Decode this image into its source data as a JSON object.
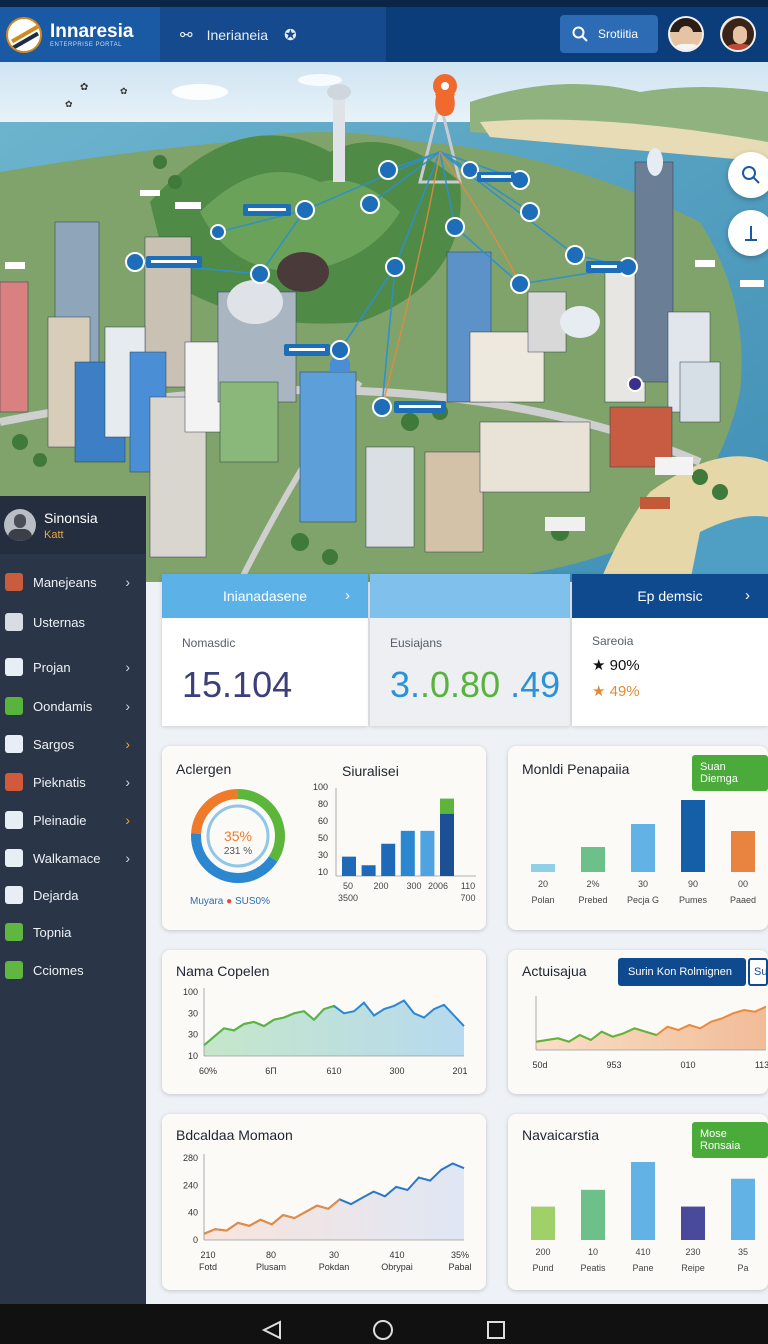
{
  "header": {
    "brand_title": "Innaresia",
    "brand_subtitle": "ENTERPRISE PORTAL",
    "nav_tab_label": "Inerianeia",
    "search_label": "Srotiitia"
  },
  "map": {
    "pin_color": "#ef6a2c"
  },
  "profile": {
    "name": "Sinonsia",
    "role": "Katt"
  },
  "sidebar": {
    "items": [
      {
        "label": "Manejeans",
        "icon": "folder-icon",
        "color": "#c95c3c",
        "chevron": true
      },
      {
        "label": "Usternas",
        "icon": "gear-icon",
        "color": "#d8dde4",
        "chevron": false
      },
      {
        "label": "Projan",
        "icon": "briefcase-icon",
        "color": "#e8eef6",
        "chevron": true
      },
      {
        "label": "Oondamis",
        "icon": "calendar-icon",
        "color": "#58b43c",
        "chevron": true
      },
      {
        "label": "Sargos",
        "icon": "table-icon",
        "color": "#e8eef6",
        "chevron": true,
        "chevron_color": "#e7a93a"
      },
      {
        "label": "Pieknatis",
        "icon": "tools-icon",
        "color": "#d05a3a",
        "chevron": true
      },
      {
        "label": "Pleinadie",
        "icon": "network-icon",
        "color": "#e8eef6",
        "chevron": true,
        "chevron_color": "#e7a93a"
      },
      {
        "label": "Walkamace",
        "icon": "puzzle-icon",
        "color": "#e8eef6",
        "chevron": true
      },
      {
        "label": "Dejarda",
        "icon": "gauge-icon",
        "color": "#e8eef6",
        "chevron": false
      },
      {
        "label": "Topnia",
        "icon": "monitor-icon",
        "color": "#5fb641",
        "chevron": false
      },
      {
        "label": "Cciomes",
        "icon": "key-icon",
        "color": "#5fb641",
        "chevron": false
      }
    ]
  },
  "kpis": [
    {
      "head": "Inianadasene",
      "label": "Nomasdic",
      "value": "15.104"
    },
    {
      "head": "",
      "label": "Eusiajans",
      "value_parts": [
        "3.",
        ".0.80",
        " .49"
      ]
    },
    {
      "head": "Ep demsic",
      "label": "Sareoia",
      "line1": "★ 90%",
      "line2": "★ 49%"
    }
  ],
  "cards": {
    "allergen": {
      "title": "Aclergen",
      "donut_top": "35%",
      "donut_bottom": "231 %",
      "legend_a": "Muyara",
      "legend_b": "SUS0%",
      "subchart_title": "Siuralisei"
    },
    "pers": {
      "title": "Monldi Penapaiia",
      "button": "Suan Diemga"
    },
    "nama": {
      "title": "Nama Copelen"
    },
    "activ": {
      "title": "Actuisajua",
      "button": "Surin Kon Rolmignen",
      "button2": "Su"
    },
    "bdc": {
      "title": "Bdcaldaa Momaon"
    },
    "nav": {
      "title": "Navaicarstia",
      "button": "Mose Ronsaia"
    }
  },
  "chart_data": [
    {
      "type": "bar",
      "title": "Siuralisei",
      "categories": [
        "50",
        "200",
        "300",
        "2006",
        "110"
      ],
      "categories_line2": [
        "3500",
        "",
        "",
        "",
        "700"
      ],
      "values": [
        18,
        10,
        30,
        42,
        42,
        58
      ],
      "overlay_top": 14,
      "yticks": [
        "100",
        "80",
        "60",
        "50",
        "30",
        "10"
      ],
      "ylim": [
        0,
        100
      ]
    },
    {
      "type": "bar",
      "title": "Monldi Penapaiia",
      "categories": [
        "Polan",
        "Prebed",
        "Pecja G",
        "Pumes",
        "Paaed"
      ],
      "data_labels": [
        "20",
        "2%",
        "30",
        "90",
        "00"
      ],
      "values": [
        8,
        25,
        48,
        72,
        41
      ],
      "colors": [
        "#8fd0e8",
        "#6dc08a",
        "#63b2e6",
        "#155fa8",
        "#e98340"
      ]
    },
    {
      "type": "area",
      "title": "Nama Copelen",
      "yticks": [
        "100",
        "30",
        "30",
        "10"
      ],
      "xticks": [
        "60%",
        "6Π",
        "610",
        "300",
        "201"
      ],
      "values": [
        10,
        18,
        26,
        24,
        30,
        32,
        28,
        34,
        36,
        40,
        42,
        34,
        44,
        47,
        40,
        42,
        50,
        38,
        44,
        47,
        52,
        40,
        36,
        44,
        48,
        38,
        28
      ]
    },
    {
      "type": "area",
      "title": "Actuisajua",
      "xticks": [
        "50d",
        "953",
        "010",
        "113"
      ],
      "values": [
        10,
        12,
        14,
        10,
        18,
        12,
        22,
        16,
        20,
        26,
        22,
        18,
        28,
        24,
        30,
        26,
        34,
        38,
        44,
        48,
        46,
        52
      ]
    },
    {
      "type": "area",
      "title": "Bdcaldaa Momaon",
      "yticks": [
        "280",
        "240",
        "40",
        "0"
      ],
      "xticks": [
        "210",
        "80",
        "30",
        "410",
        "35%"
      ],
      "xlabels": [
        "Fotd",
        "Plusam",
        "Pokdan",
        "Obrypai",
        "Pabal"
      ],
      "values": [
        8,
        14,
        12,
        22,
        18,
        26,
        20,
        32,
        28,
        36,
        44,
        40,
        52,
        46,
        54,
        62,
        56,
        68,
        64,
        80,
        76,
        90,
        98,
        92
      ]
    },
    {
      "type": "bar",
      "title": "Navaicarstia",
      "categories": [
        "Pund",
        "Peatis",
        "Pane",
        "Reipe",
        "Pa"
      ],
      "data_labels": [
        "200",
        "10",
        "410",
        "230",
        "35"
      ],
      "values": [
        30,
        45,
        70,
        30,
        55
      ],
      "colors": [
        "#9fd06a",
        "#6dc08a",
        "#63b2e6",
        "#4a4a9c",
        "#63b2e6"
      ]
    }
  ]
}
